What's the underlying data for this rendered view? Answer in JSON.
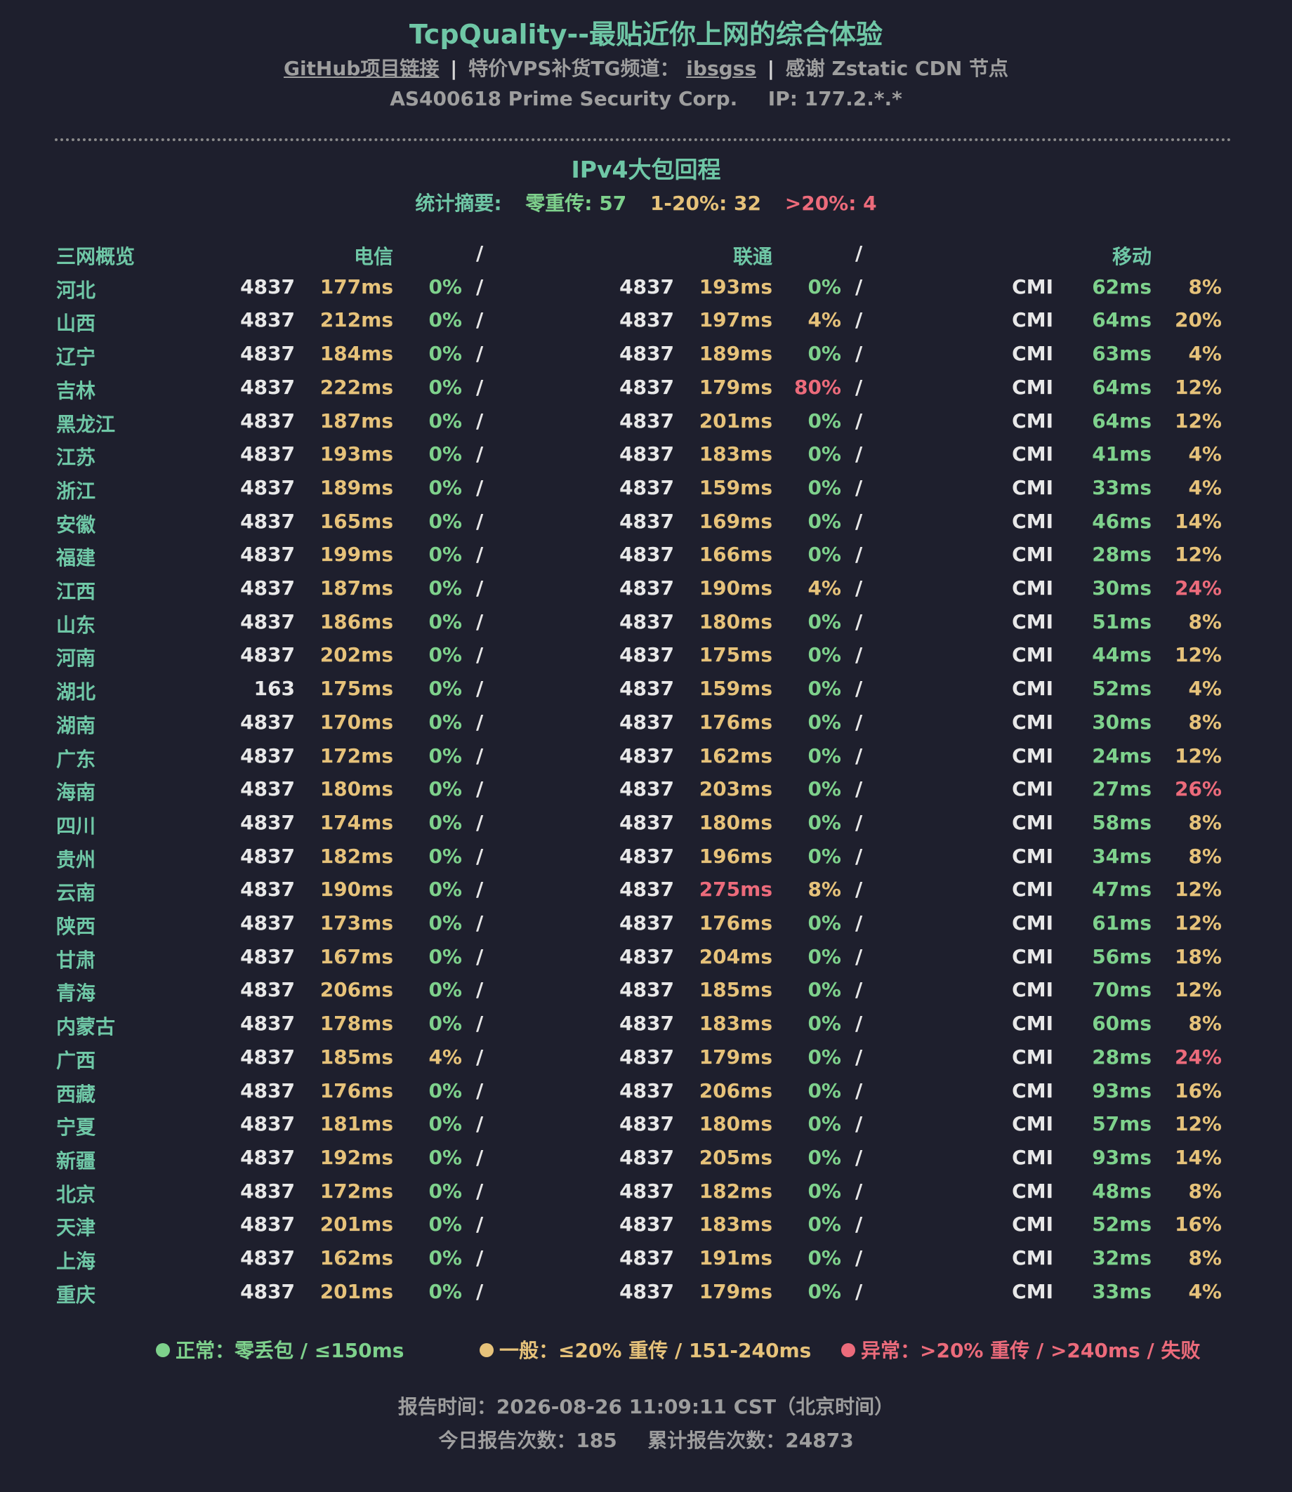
{
  "header": {
    "title": "TcpQuality--最贴近你上网的综合体验",
    "github_link": "GitHub项目链接",
    "sep": "|",
    "tg_label": "特价VPS补货TG频道：",
    "tg_link": "ibsgss",
    "thanks": "感谢 Zstatic CDN 节点",
    "asn": "AS400618 Prime Security Corp.",
    "ip": "IP: 177.2.*.*"
  },
  "section": {
    "title": "IPv4大包回程",
    "summary_label": "统计摘要:",
    "zero": "零重传: 57",
    "mid": "1-20%: 32",
    "high": ">20%: 4"
  },
  "table": {
    "headers": {
      "overview": "三网概览",
      "ct": "电信",
      "cu": "联通",
      "cm": "移动",
      "slash": "/"
    },
    "rows": [
      {
        "prov": "河北",
        "ct_as": "4837",
        "ct_ms": "177ms",
        "ct_ms_c": "yellow",
        "ct_p": "0%",
        "ct_p_c": "green",
        "cu_as": "4837",
        "cu_ms": "193ms",
        "cu_ms_c": "yellow",
        "cu_p": "0%",
        "cu_p_c": "green",
        "cm_as": "CMI",
        "cm_ms": "62ms",
        "cm_ms_c": "green",
        "cm_p": "8%",
        "cm_p_c": "yellow"
      },
      {
        "prov": "山西",
        "ct_as": "4837",
        "ct_ms": "212ms",
        "ct_ms_c": "yellow",
        "ct_p": "0%",
        "ct_p_c": "green",
        "cu_as": "4837",
        "cu_ms": "197ms",
        "cu_ms_c": "yellow",
        "cu_p": "4%",
        "cu_p_c": "yellow",
        "cm_as": "CMI",
        "cm_ms": "64ms",
        "cm_ms_c": "green",
        "cm_p": "20%",
        "cm_p_c": "yellow"
      },
      {
        "prov": "辽宁",
        "ct_as": "4837",
        "ct_ms": "184ms",
        "ct_ms_c": "yellow",
        "ct_p": "0%",
        "ct_p_c": "green",
        "cu_as": "4837",
        "cu_ms": "189ms",
        "cu_ms_c": "yellow",
        "cu_p": "0%",
        "cu_p_c": "green",
        "cm_as": "CMI",
        "cm_ms": "63ms",
        "cm_ms_c": "green",
        "cm_p": "4%",
        "cm_p_c": "yellow"
      },
      {
        "prov": "吉林",
        "ct_as": "4837",
        "ct_ms": "222ms",
        "ct_ms_c": "yellow",
        "ct_p": "0%",
        "ct_p_c": "green",
        "cu_as": "4837",
        "cu_ms": "179ms",
        "cu_ms_c": "yellow",
        "cu_p": "80%",
        "cu_p_c": "red",
        "cm_as": "CMI",
        "cm_ms": "64ms",
        "cm_ms_c": "green",
        "cm_p": "12%",
        "cm_p_c": "yellow"
      },
      {
        "prov": "黑龙江",
        "ct_as": "4837",
        "ct_ms": "187ms",
        "ct_ms_c": "yellow",
        "ct_p": "0%",
        "ct_p_c": "green",
        "cu_as": "4837",
        "cu_ms": "201ms",
        "cu_ms_c": "yellow",
        "cu_p": "0%",
        "cu_p_c": "green",
        "cm_as": "CMI",
        "cm_ms": "64ms",
        "cm_ms_c": "green",
        "cm_p": "12%",
        "cm_p_c": "yellow"
      },
      {
        "prov": "江苏",
        "ct_as": "4837",
        "ct_ms": "193ms",
        "ct_ms_c": "yellow",
        "ct_p": "0%",
        "ct_p_c": "green",
        "cu_as": "4837",
        "cu_ms": "183ms",
        "cu_ms_c": "yellow",
        "cu_p": "0%",
        "cu_p_c": "green",
        "cm_as": "CMI",
        "cm_ms": "41ms",
        "cm_ms_c": "green",
        "cm_p": "4%",
        "cm_p_c": "yellow"
      },
      {
        "prov": "浙江",
        "ct_as": "4837",
        "ct_ms": "189ms",
        "ct_ms_c": "yellow",
        "ct_p": "0%",
        "ct_p_c": "green",
        "cu_as": "4837",
        "cu_ms": "159ms",
        "cu_ms_c": "yellow",
        "cu_p": "0%",
        "cu_p_c": "green",
        "cm_as": "CMI",
        "cm_ms": "33ms",
        "cm_ms_c": "green",
        "cm_p": "4%",
        "cm_p_c": "yellow"
      },
      {
        "prov": "安徽",
        "ct_as": "4837",
        "ct_ms": "165ms",
        "ct_ms_c": "yellow",
        "ct_p": "0%",
        "ct_p_c": "green",
        "cu_as": "4837",
        "cu_ms": "169ms",
        "cu_ms_c": "yellow",
        "cu_p": "0%",
        "cu_p_c": "green",
        "cm_as": "CMI",
        "cm_ms": "46ms",
        "cm_ms_c": "green",
        "cm_p": "14%",
        "cm_p_c": "yellow"
      },
      {
        "prov": "福建",
        "ct_as": "4837",
        "ct_ms": "199ms",
        "ct_ms_c": "yellow",
        "ct_p": "0%",
        "ct_p_c": "green",
        "cu_as": "4837",
        "cu_ms": "166ms",
        "cu_ms_c": "yellow",
        "cu_p": "0%",
        "cu_p_c": "green",
        "cm_as": "CMI",
        "cm_ms": "28ms",
        "cm_ms_c": "green",
        "cm_p": "12%",
        "cm_p_c": "yellow"
      },
      {
        "prov": "江西",
        "ct_as": "4837",
        "ct_ms": "187ms",
        "ct_ms_c": "yellow",
        "ct_p": "0%",
        "ct_p_c": "green",
        "cu_as": "4837",
        "cu_ms": "190ms",
        "cu_ms_c": "yellow",
        "cu_p": "4%",
        "cu_p_c": "yellow",
        "cm_as": "CMI",
        "cm_ms": "30ms",
        "cm_ms_c": "green",
        "cm_p": "24%",
        "cm_p_c": "red"
      },
      {
        "prov": "山东",
        "ct_as": "4837",
        "ct_ms": "186ms",
        "ct_ms_c": "yellow",
        "ct_p": "0%",
        "ct_p_c": "green",
        "cu_as": "4837",
        "cu_ms": "180ms",
        "cu_ms_c": "yellow",
        "cu_p": "0%",
        "cu_p_c": "green",
        "cm_as": "CMI",
        "cm_ms": "51ms",
        "cm_ms_c": "green",
        "cm_p": "8%",
        "cm_p_c": "yellow"
      },
      {
        "prov": "河南",
        "ct_as": "4837",
        "ct_ms": "202ms",
        "ct_ms_c": "yellow",
        "ct_p": "0%",
        "ct_p_c": "green",
        "cu_as": "4837",
        "cu_ms": "175ms",
        "cu_ms_c": "yellow",
        "cu_p": "0%",
        "cu_p_c": "green",
        "cm_as": "CMI",
        "cm_ms": "44ms",
        "cm_ms_c": "green",
        "cm_p": "12%",
        "cm_p_c": "yellow"
      },
      {
        "prov": "湖北",
        "ct_as": "163",
        "ct_ms": "175ms",
        "ct_ms_c": "yellow",
        "ct_p": "0%",
        "ct_p_c": "green",
        "cu_as": "4837",
        "cu_ms": "159ms",
        "cu_ms_c": "yellow",
        "cu_p": "0%",
        "cu_p_c": "green",
        "cm_as": "CMI",
        "cm_ms": "52ms",
        "cm_ms_c": "green",
        "cm_p": "4%",
        "cm_p_c": "yellow"
      },
      {
        "prov": "湖南",
        "ct_as": "4837",
        "ct_ms": "170ms",
        "ct_ms_c": "yellow",
        "ct_p": "0%",
        "ct_p_c": "green",
        "cu_as": "4837",
        "cu_ms": "176ms",
        "cu_ms_c": "yellow",
        "cu_p": "0%",
        "cu_p_c": "green",
        "cm_as": "CMI",
        "cm_ms": "30ms",
        "cm_ms_c": "green",
        "cm_p": "8%",
        "cm_p_c": "yellow"
      },
      {
        "prov": "广东",
        "ct_as": "4837",
        "ct_ms": "172ms",
        "ct_ms_c": "yellow",
        "ct_p": "0%",
        "ct_p_c": "green",
        "cu_as": "4837",
        "cu_ms": "162ms",
        "cu_ms_c": "yellow",
        "cu_p": "0%",
        "cu_p_c": "green",
        "cm_as": "CMI",
        "cm_ms": "24ms",
        "cm_ms_c": "green",
        "cm_p": "12%",
        "cm_p_c": "yellow"
      },
      {
        "prov": "海南",
        "ct_as": "4837",
        "ct_ms": "180ms",
        "ct_ms_c": "yellow",
        "ct_p": "0%",
        "ct_p_c": "green",
        "cu_as": "4837",
        "cu_ms": "203ms",
        "cu_ms_c": "yellow",
        "cu_p": "0%",
        "cu_p_c": "green",
        "cm_as": "CMI",
        "cm_ms": "27ms",
        "cm_ms_c": "green",
        "cm_p": "26%",
        "cm_p_c": "red"
      },
      {
        "prov": "四川",
        "ct_as": "4837",
        "ct_ms": "174ms",
        "ct_ms_c": "yellow",
        "ct_p": "0%",
        "ct_p_c": "green",
        "cu_as": "4837",
        "cu_ms": "180ms",
        "cu_ms_c": "yellow",
        "cu_p": "0%",
        "cu_p_c": "green",
        "cm_as": "CMI",
        "cm_ms": "58ms",
        "cm_ms_c": "green",
        "cm_p": "8%",
        "cm_p_c": "yellow"
      },
      {
        "prov": "贵州",
        "ct_as": "4837",
        "ct_ms": "182ms",
        "ct_ms_c": "yellow",
        "ct_p": "0%",
        "ct_p_c": "green",
        "cu_as": "4837",
        "cu_ms": "196ms",
        "cu_ms_c": "yellow",
        "cu_p": "0%",
        "cu_p_c": "green",
        "cm_as": "CMI",
        "cm_ms": "34ms",
        "cm_ms_c": "green",
        "cm_p": "8%",
        "cm_p_c": "yellow"
      },
      {
        "prov": "云南",
        "ct_as": "4837",
        "ct_ms": "190ms",
        "ct_ms_c": "yellow",
        "ct_p": "0%",
        "ct_p_c": "green",
        "cu_as": "4837",
        "cu_ms": "275ms",
        "cu_ms_c": "red",
        "cu_p": "8%",
        "cu_p_c": "yellow",
        "cm_as": "CMI",
        "cm_ms": "47ms",
        "cm_ms_c": "green",
        "cm_p": "12%",
        "cm_p_c": "yellow"
      },
      {
        "prov": "陕西",
        "ct_as": "4837",
        "ct_ms": "173ms",
        "ct_ms_c": "yellow",
        "ct_p": "0%",
        "ct_p_c": "green",
        "cu_as": "4837",
        "cu_ms": "176ms",
        "cu_ms_c": "yellow",
        "cu_p": "0%",
        "cu_p_c": "green",
        "cm_as": "CMI",
        "cm_ms": "61ms",
        "cm_ms_c": "green",
        "cm_p": "12%",
        "cm_p_c": "yellow"
      },
      {
        "prov": "甘肃",
        "ct_as": "4837",
        "ct_ms": "167ms",
        "ct_ms_c": "yellow",
        "ct_p": "0%",
        "ct_p_c": "green",
        "cu_as": "4837",
        "cu_ms": "204ms",
        "cu_ms_c": "yellow",
        "cu_p": "0%",
        "cu_p_c": "green",
        "cm_as": "CMI",
        "cm_ms": "56ms",
        "cm_ms_c": "green",
        "cm_p": "18%",
        "cm_p_c": "yellow"
      },
      {
        "prov": "青海",
        "ct_as": "4837",
        "ct_ms": "206ms",
        "ct_ms_c": "yellow",
        "ct_p": "0%",
        "ct_p_c": "green",
        "cu_as": "4837",
        "cu_ms": "185ms",
        "cu_ms_c": "yellow",
        "cu_p": "0%",
        "cu_p_c": "green",
        "cm_as": "CMI",
        "cm_ms": "70ms",
        "cm_ms_c": "green",
        "cm_p": "12%",
        "cm_p_c": "yellow"
      },
      {
        "prov": "内蒙古",
        "ct_as": "4837",
        "ct_ms": "178ms",
        "ct_ms_c": "yellow",
        "ct_p": "0%",
        "ct_p_c": "green",
        "cu_as": "4837",
        "cu_ms": "183ms",
        "cu_ms_c": "yellow",
        "cu_p": "0%",
        "cu_p_c": "green",
        "cm_as": "CMI",
        "cm_ms": "60ms",
        "cm_ms_c": "green",
        "cm_p": "8%",
        "cm_p_c": "yellow"
      },
      {
        "prov": "广西",
        "ct_as": "4837",
        "ct_ms": "185ms",
        "ct_ms_c": "yellow",
        "ct_p": "4%",
        "ct_p_c": "yellow",
        "cu_as": "4837",
        "cu_ms": "179ms",
        "cu_ms_c": "yellow",
        "cu_p": "0%",
        "cu_p_c": "green",
        "cm_as": "CMI",
        "cm_ms": "28ms",
        "cm_ms_c": "green",
        "cm_p": "24%",
        "cm_p_c": "red"
      },
      {
        "prov": "西藏",
        "ct_as": "4837",
        "ct_ms": "176ms",
        "ct_ms_c": "yellow",
        "ct_p": "0%",
        "ct_p_c": "green",
        "cu_as": "4837",
        "cu_ms": "206ms",
        "cu_ms_c": "yellow",
        "cu_p": "0%",
        "cu_p_c": "green",
        "cm_as": "CMI",
        "cm_ms": "93ms",
        "cm_ms_c": "green",
        "cm_p": "16%",
        "cm_p_c": "yellow"
      },
      {
        "prov": "宁夏",
        "ct_as": "4837",
        "ct_ms": "181ms",
        "ct_ms_c": "yellow",
        "ct_p": "0%",
        "ct_p_c": "green",
        "cu_as": "4837",
        "cu_ms": "180ms",
        "cu_ms_c": "yellow",
        "cu_p": "0%",
        "cu_p_c": "green",
        "cm_as": "CMI",
        "cm_ms": "57ms",
        "cm_ms_c": "green",
        "cm_p": "12%",
        "cm_p_c": "yellow"
      },
      {
        "prov": "新疆",
        "ct_as": "4837",
        "ct_ms": "192ms",
        "ct_ms_c": "yellow",
        "ct_p": "0%",
        "ct_p_c": "green",
        "cu_as": "4837",
        "cu_ms": "205ms",
        "cu_ms_c": "yellow",
        "cu_p": "0%",
        "cu_p_c": "green",
        "cm_as": "CMI",
        "cm_ms": "93ms",
        "cm_ms_c": "green",
        "cm_p": "14%",
        "cm_p_c": "yellow"
      },
      {
        "prov": "北京",
        "ct_as": "4837",
        "ct_ms": "172ms",
        "ct_ms_c": "yellow",
        "ct_p": "0%",
        "ct_p_c": "green",
        "cu_as": "4837",
        "cu_ms": "182ms",
        "cu_ms_c": "yellow",
        "cu_p": "0%",
        "cu_p_c": "green",
        "cm_as": "CMI",
        "cm_ms": "48ms",
        "cm_ms_c": "green",
        "cm_p": "8%",
        "cm_p_c": "yellow"
      },
      {
        "prov": "天津",
        "ct_as": "4837",
        "ct_ms": "201ms",
        "ct_ms_c": "yellow",
        "ct_p": "0%",
        "ct_p_c": "green",
        "cu_as": "4837",
        "cu_ms": "183ms",
        "cu_ms_c": "yellow",
        "cu_p": "0%",
        "cu_p_c": "green",
        "cm_as": "CMI",
        "cm_ms": "52ms",
        "cm_ms_c": "green",
        "cm_p": "16%",
        "cm_p_c": "yellow"
      },
      {
        "prov": "上海",
        "ct_as": "4837",
        "ct_ms": "162ms",
        "ct_ms_c": "yellow",
        "ct_p": "0%",
        "ct_p_c": "green",
        "cu_as": "4837",
        "cu_ms": "191ms",
        "cu_ms_c": "yellow",
        "cu_p": "0%",
        "cu_p_c": "green",
        "cm_as": "CMI",
        "cm_ms": "32ms",
        "cm_ms_c": "green",
        "cm_p": "8%",
        "cm_p_c": "yellow"
      },
      {
        "prov": "重庆",
        "ct_as": "4837",
        "ct_ms": "201ms",
        "ct_ms_c": "yellow",
        "ct_p": "0%",
        "ct_p_c": "green",
        "cu_as": "4837",
        "cu_ms": "179ms",
        "cu_ms_c": "yellow",
        "cu_p": "0%",
        "cu_p_c": "green",
        "cm_as": "CMI",
        "cm_ms": "33ms",
        "cm_ms_c": "green",
        "cm_p": "4%",
        "cm_p_c": "yellow"
      }
    ]
  },
  "legend": {
    "normal": "正常：零丢包 / ≤150ms",
    "normal_color": "#7ed18c",
    "fair": "一般：≤20% 重传 / 151-240ms",
    "fair_color": "#e6c27a",
    "bad": "异常：>20% 重传 / >240ms / 失败",
    "bad_color": "#ec6b7b"
  },
  "footer": {
    "report_time": "报告时间：2026-08-26 11:09:11 CST（北京时间）",
    "today_count": "今日报告次数：185",
    "total_count": "累计报告次数：24873"
  }
}
